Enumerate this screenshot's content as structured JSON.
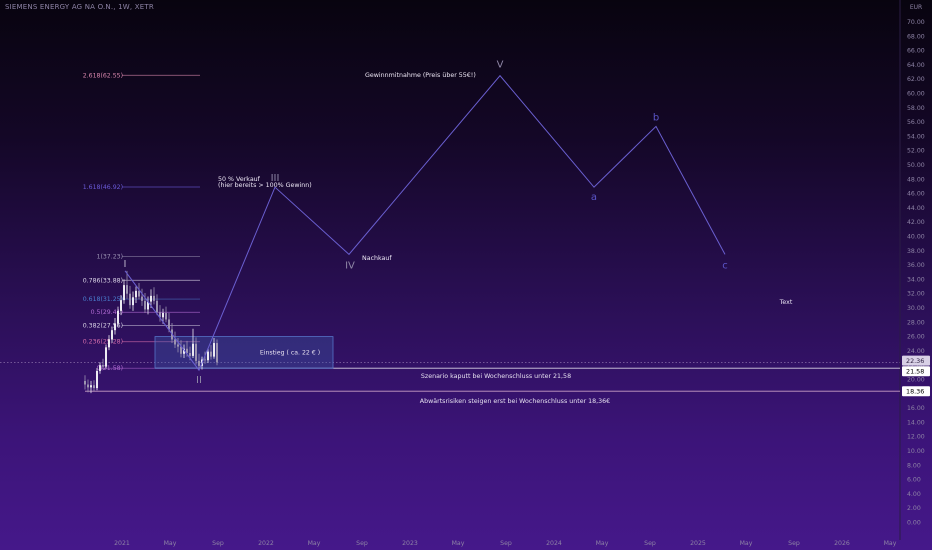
{
  "header": {
    "symbol": "SIEMENS ENERGY AG NA O.N., 1W, XETR"
  },
  "chart_data": {
    "type": "candlestick",
    "currency": "EUR",
    "y_axis": {
      "range": [
        0,
        72
      ],
      "tick_step": 2,
      "ticks": [
        "70.00",
        "68.00",
        "66.00",
        "64.00",
        "62.00",
        "60.00",
        "58.00",
        "56.00",
        "54.00",
        "52.00",
        "50.00",
        "48.00",
        "46.00",
        "44.00",
        "42.00",
        "40.00",
        "38.00",
        "36.00",
        "34.00",
        "32.00",
        "30.00",
        "28.00",
        "26.00",
        "24.00",
        "22.00",
        "20.00",
        "18.00",
        "16.00",
        "14.00",
        "12.00",
        "10.00",
        "8.00",
        "6.00",
        "4.00",
        "2.00",
        "0.00"
      ]
    },
    "x_axis": {
      "ticks": [
        "2021",
        "May",
        "Sep",
        "2022",
        "May",
        "Sep",
        "2023",
        "May",
        "Sep",
        "2024",
        "May",
        "Sep",
        "2025",
        "May",
        "Sep",
        "2026",
        "May"
      ]
    },
    "price_labels": [
      {
        "text": "22.36",
        "value": 22.36,
        "color": "#d8d0e6",
        "text_color": "#2a1d3d"
      },
      {
        "text": "21.58",
        "value": 21.58,
        "color": "#ffffff",
        "text_color": "#000000"
      },
      {
        "text": "18.36",
        "value": 18.36,
        "color": "#ffffff",
        "text_color": "#000000"
      }
    ],
    "fib_levels": [
      {
        "label": "2.618(62.55)",
        "value": 62.55,
        "color": "#d887ad"
      },
      {
        "label": "1.618(46.92)",
        "value": 46.92,
        "color": "#6a5ad8"
      },
      {
        "label": "1(37.23)",
        "value": 37.23,
        "color": "#9a92b2"
      },
      {
        "label": "0.786(33.88)",
        "value": 33.88,
        "color": "#d9d3e6"
      },
      {
        "label": "0.618(31.25)",
        "value": 31.25,
        "color": "#4a7fd0"
      },
      {
        "label": "0.5(29.41)",
        "value": 29.41,
        "color": "#b06ad2"
      },
      {
        "label": "0.382(27.56)",
        "value": 27.56,
        "color": "#d9d3e6"
      },
      {
        "label": "0.236(25.28)",
        "value": 25.28,
        "color": "#d16aa9"
      },
      {
        "label": "0(21.58)",
        "value": 21.58,
        "color": "#b06ad2"
      }
    ],
    "horizontal_lines": [
      {
        "value": 22.36,
        "color": "#b59ac9",
        "dashed": true
      },
      {
        "value": 21.58,
        "color": "#d9d3e6",
        "dashed": false
      },
      {
        "value": 18.36,
        "color": "#c9a0c6",
        "dashed": false
      }
    ],
    "entry_zone": {
      "y_top": 26.0,
      "y_bottom": 21.58,
      "label": "Einstieg ( ca. 22 € )"
    },
    "elliott_waves": [
      {
        "label": "I",
        "value": 35.2
      },
      {
        "label": "II",
        "value": 21.3
      },
      {
        "label": "III",
        "value": 46.9
      },
      {
        "label": "IV",
        "value": 37.5
      },
      {
        "label": "V",
        "value": 62.5
      },
      {
        "label": "a",
        "value": 46.9
      },
      {
        "label": "b",
        "value": 55.4
      },
      {
        "label": "c",
        "value": 37.5
      }
    ],
    "annotations": [
      {
        "text": "50 % Verkauf"
      },
      {
        "text": "(hier bereits > 100% Gewinn)"
      },
      {
        "text": "Nachkauf"
      },
      {
        "text": "Gewinnmitnahme (Preis über 55€!)"
      },
      {
        "text": "Szenario kaputt bei Wochenschluss unter 21,58"
      },
      {
        "text": "Abwärtsrisiken steigen erst bei Wochenschluss unter 18,36€"
      },
      {
        "text": "Text"
      }
    ],
    "candles": [
      [
        19.8,
        20.6,
        18.6,
        19.3
      ],
      [
        19.3,
        20.0,
        18.2,
        18.9
      ],
      [
        18.9,
        19.8,
        18.1,
        19.2
      ],
      [
        19.2,
        19.9,
        18.4,
        18.8
      ],
      [
        18.8,
        21.6,
        18.5,
        21.2
      ],
      [
        21.2,
        22.4,
        20.8,
        22.0
      ],
      [
        22.0,
        22.9,
        21.4,
        21.8
      ],
      [
        21.8,
        24.9,
        21.5,
        24.5
      ],
      [
        24.5,
        26.2,
        24.1,
        25.6
      ],
      [
        25.6,
        27.4,
        25.1,
        26.9
      ],
      [
        26.9,
        28.6,
        26.3,
        27.8
      ],
      [
        27.8,
        30.2,
        27.3,
        29.6
      ],
      [
        29.6,
        31.8,
        29.0,
        31.1
      ],
      [
        31.1,
        34.0,
        30.6,
        33.2
      ],
      [
        33.2,
        35.2,
        31.3,
        32.0
      ],
      [
        32.0,
        33.1,
        29.9,
        30.4
      ],
      [
        30.4,
        32.3,
        29.6,
        31.5
      ],
      [
        31.5,
        33.0,
        30.7,
        32.4
      ],
      [
        32.4,
        33.5,
        31.2,
        31.6
      ],
      [
        31.6,
        32.7,
        30.3,
        31.0
      ],
      [
        31.0,
        32.1,
        29.3,
        29.8
      ],
      [
        29.8,
        31.6,
        29.1,
        30.9
      ],
      [
        30.9,
        32.6,
        30.0,
        31.7
      ],
      [
        31.7,
        32.9,
        30.5,
        31.0
      ],
      [
        31.0,
        31.9,
        29.0,
        29.4
      ],
      [
        29.4,
        30.4,
        28.1,
        28.7
      ],
      [
        28.7,
        29.9,
        27.8,
        29.3
      ],
      [
        29.3,
        30.2,
        28.0,
        28.4
      ],
      [
        28.4,
        29.3,
        26.6,
        27.0
      ],
      [
        27.0,
        27.9,
        25.1,
        25.6
      ],
      [
        25.6,
        26.7,
        24.4,
        24.9
      ],
      [
        24.9,
        25.8,
        23.8,
        24.6
      ],
      [
        24.6,
        25.5,
        23.1,
        23.6
      ],
      [
        23.6,
        24.9,
        23.0,
        24.3
      ],
      [
        24.3,
        25.4,
        23.2,
        23.7
      ],
      [
        23.7,
        24.6,
        22.7,
        23.3
      ],
      [
        23.3,
        27.1,
        23.0,
        25.0
      ],
      [
        25.0,
        25.9,
        22.1,
        22.6
      ],
      [
        22.6,
        23.6,
        21.3,
        21.9
      ],
      [
        21.9,
        23.2,
        21.4,
        22.8
      ],
      [
        22.8,
        23.9,
        22.2,
        22.7
      ],
      [
        22.7,
        24.4,
        22.3,
        23.9
      ],
      [
        23.9,
        24.8,
        22.8,
        23.2
      ],
      [
        23.2,
        25.8,
        22.9,
        25.1
      ],
      [
        25.1,
        25.6,
        22.0,
        22.4
      ]
    ]
  }
}
